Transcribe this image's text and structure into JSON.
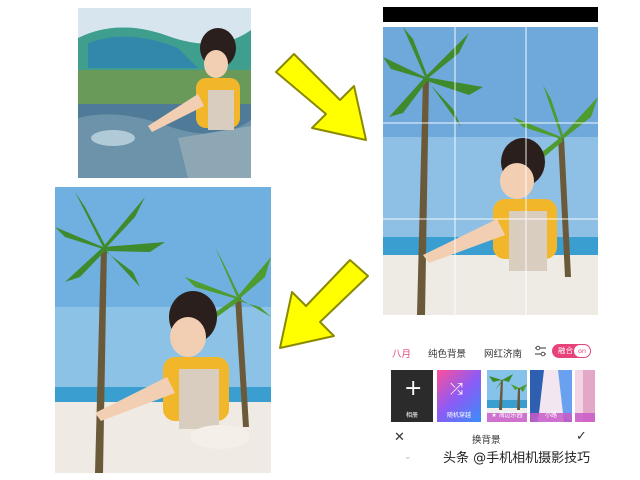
{
  "editor": {
    "tabs": [
      {
        "label": "八月"
      },
      {
        "label": "纯色背景"
      },
      {
        "label": "网红济南"
      }
    ],
    "fusion_toggle": {
      "label": "融合",
      "state": "on"
    },
    "thumbnails": [
      {
        "label": "相册"
      },
      {
        "label": "随机穿越"
      },
      {
        "label": "★ 海边乐园"
      },
      {
        "label": "小路"
      }
    ],
    "bottom_title": "换背景",
    "icons": {
      "close": "close-icon",
      "confirm": "check-icon",
      "adjust": "sliders-icon",
      "shuffle": "shuffle-icon",
      "add": "plus-icon",
      "expand": "chevron-down-icon"
    },
    "accent_color": "#e8427a"
  },
  "watermark": "头条 @手机相机摄影技巧",
  "arrow_color": "#ffff00"
}
